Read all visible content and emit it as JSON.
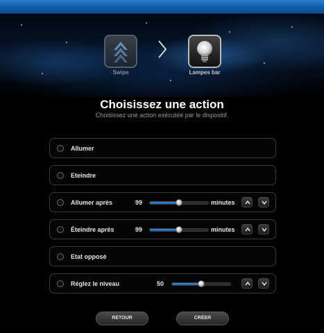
{
  "wizard": {
    "steps": [
      {
        "label": "Swipe",
        "icon": "swipe-arrows-icon"
      },
      {
        "label": "Lampes bar",
        "icon": "light-bulb-icon"
      }
    ]
  },
  "header": {
    "title": "Choisissez une action",
    "subtitle": "Choisissez une action exécutée par le dispositif."
  },
  "options": [
    {
      "label": "Allumer"
    },
    {
      "label": "Eteindre"
    },
    {
      "label": "Allumer après",
      "value": "99",
      "unit": "minutes",
      "slider_fraction": 0.5
    },
    {
      "label": "Éteindre après",
      "value": "99",
      "unit": "minutes",
      "slider_fraction": 0.5
    },
    {
      "label": "Etat opposé"
    },
    {
      "label": "Réglez le niveau",
      "value": "50",
      "slider_fraction": 0.5
    }
  ],
  "buttons": {
    "back": "RETOUR",
    "create": "CRÉER"
  },
  "colors": {
    "accent": "#1b6ad0",
    "slider_fill": "#3b8ee0"
  }
}
